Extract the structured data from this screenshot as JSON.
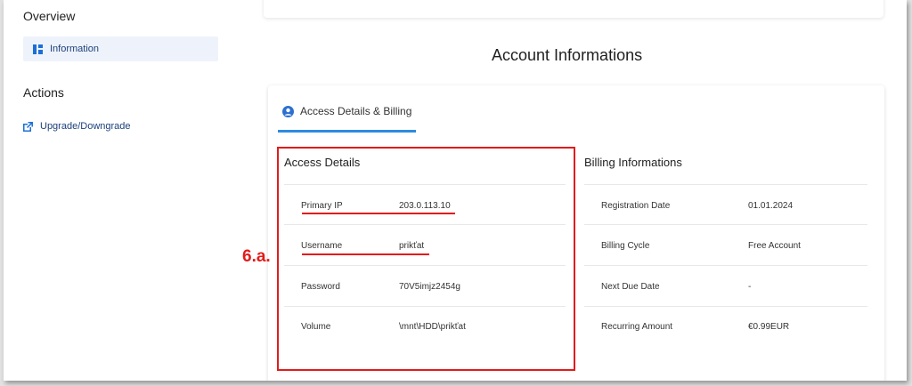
{
  "sidebar": {
    "overview_heading": "Overview",
    "information_label": "Information",
    "actions_heading": "Actions",
    "upgrade_label": "Upgrade/Downgrade"
  },
  "main": {
    "title": "Account Informations",
    "tab_label": "Access Details & Billing",
    "access": {
      "title": "Access Details",
      "rows": [
        {
          "label": "Primary IP",
          "value": "203.0.113.10"
        },
        {
          "label": "Username",
          "value": "prikťat"
        },
        {
          "label": "Password",
          "value": "70V5imjz2454g"
        },
        {
          "label": "Volume",
          "value": "\\mnt\\HDD\\prikťat"
        }
      ]
    },
    "billing": {
      "title": "Billing Informations",
      "rows": [
        {
          "label": "Registration Date",
          "value": "01.01.2024"
        },
        {
          "label": "Billing Cycle",
          "value": "Free Account"
        },
        {
          "label": "Next Due Date",
          "value": "-"
        },
        {
          "label": "Recurring Amount",
          "value": "€0.99EUR"
        }
      ]
    }
  },
  "annotation": {
    "step_label": "6.a."
  },
  "colors": {
    "accent": "#2d8be0",
    "link": "#1c3f7a",
    "annotation": "#e21b1b"
  }
}
